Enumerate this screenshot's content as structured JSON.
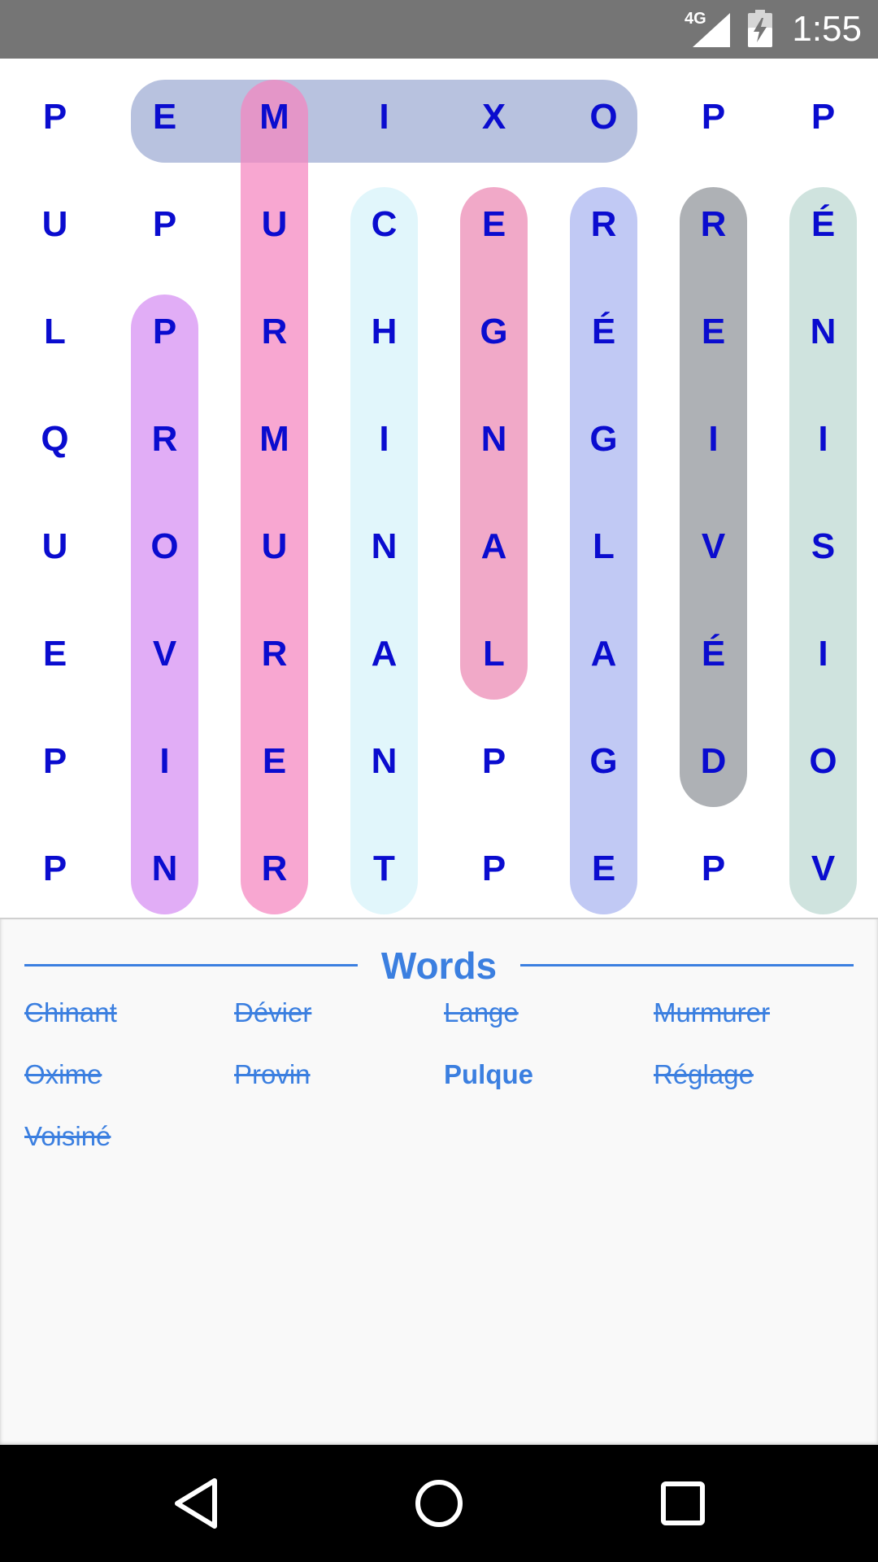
{
  "status_bar": {
    "network": "4G",
    "time": "1:55",
    "icons": [
      "signal-icon",
      "battery-charging-icon"
    ]
  },
  "grid": {
    "rows": [
      [
        "P",
        "E",
        "M",
        "I",
        "X",
        "O",
        "P",
        "P"
      ],
      [
        "U",
        "P",
        "U",
        "C",
        "E",
        "R",
        "R",
        "É"
      ],
      [
        "L",
        "P",
        "R",
        "H",
        "G",
        "É",
        "E",
        "N"
      ],
      [
        "Q",
        "R",
        "M",
        "I",
        "N",
        "G",
        "I",
        "I"
      ],
      [
        "U",
        "O",
        "U",
        "N",
        "A",
        "L",
        "V",
        "S"
      ],
      [
        "E",
        "V",
        "R",
        "A",
        "L",
        "A",
        "É",
        "I"
      ],
      [
        "P",
        "I",
        "E",
        "N",
        "P",
        "G",
        "D",
        "O"
      ],
      [
        "P",
        "N",
        "R",
        "T",
        "P",
        "E",
        "P",
        "V"
      ]
    ],
    "highlights": [
      {
        "word": "Oxime",
        "color": "#9aa8d2"
      },
      {
        "word": "Murmurer",
        "color": "#f585bf"
      },
      {
        "word": "Provin",
        "color": "#d58ef2"
      },
      {
        "word": "Chinant",
        "color": "#d6f3fa"
      },
      {
        "word": "Lange",
        "color": "#ec88b3"
      },
      {
        "word": "Réglage",
        "color": "#a9b4f0"
      },
      {
        "word": "Dévier",
        "color": "#8f9398"
      },
      {
        "word": "Voisiné",
        "color": "#bcd8d1"
      }
    ]
  },
  "words_panel": {
    "title": "Words",
    "words": [
      {
        "label": "Chinant",
        "found": true
      },
      {
        "label": "Dévier",
        "found": true
      },
      {
        "label": "Lange",
        "found": true
      },
      {
        "label": "Murmurer",
        "found": true
      },
      {
        "label": "Oxime",
        "found": true
      },
      {
        "label": "Provin",
        "found": true
      },
      {
        "label": "Pulque",
        "found": false
      },
      {
        "label": "Réglage",
        "found": true
      },
      {
        "label": "Voisiné",
        "found": true
      }
    ]
  },
  "nav_bar": {
    "icons": [
      "back-icon",
      "home-icon",
      "recents-icon"
    ]
  }
}
